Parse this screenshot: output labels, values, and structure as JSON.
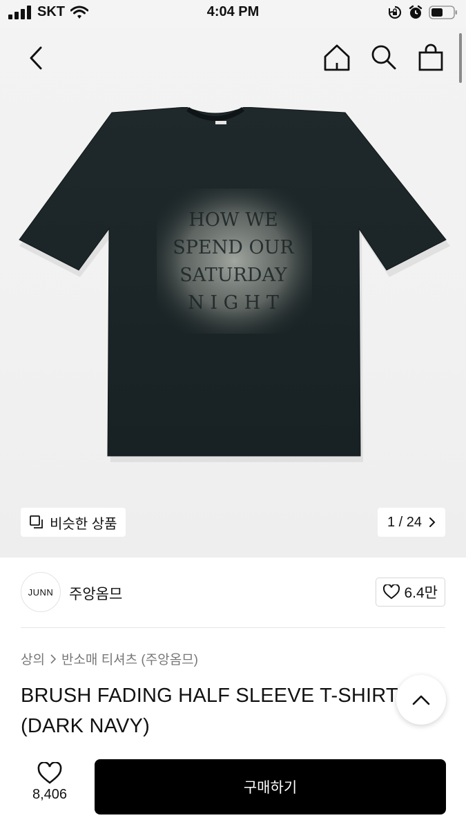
{
  "status_bar": {
    "carrier": "SKT",
    "time": "4:04 PM"
  },
  "nav": {
    "back_icon": "chevron-left-icon",
    "icons": [
      "home-icon",
      "search-icon",
      "shopping-bag-icon"
    ]
  },
  "hero": {
    "shirt_text_lines": [
      "HOW    WE",
      "SPEND OUR",
      "SATURDAY",
      "N I G H T"
    ],
    "similar_label": "비슷한 상품",
    "pager": "1 / 24"
  },
  "seller": {
    "logo_text": "JUNN",
    "name": "주앙옴므",
    "likes": "6.4만"
  },
  "breadcrumb": {
    "category": "상의",
    "subcategory": "반소매 티셔츠 (주앙옴므)"
  },
  "product": {
    "title": "BRUSH FADING HALF SLEEVE T-SHIRTS (DARK NAVY)"
  },
  "bottom": {
    "wish_count": "8,406",
    "buy_label": "구매하기"
  },
  "colors": {
    "shirt": "#1c2628",
    "button": "#000000"
  }
}
